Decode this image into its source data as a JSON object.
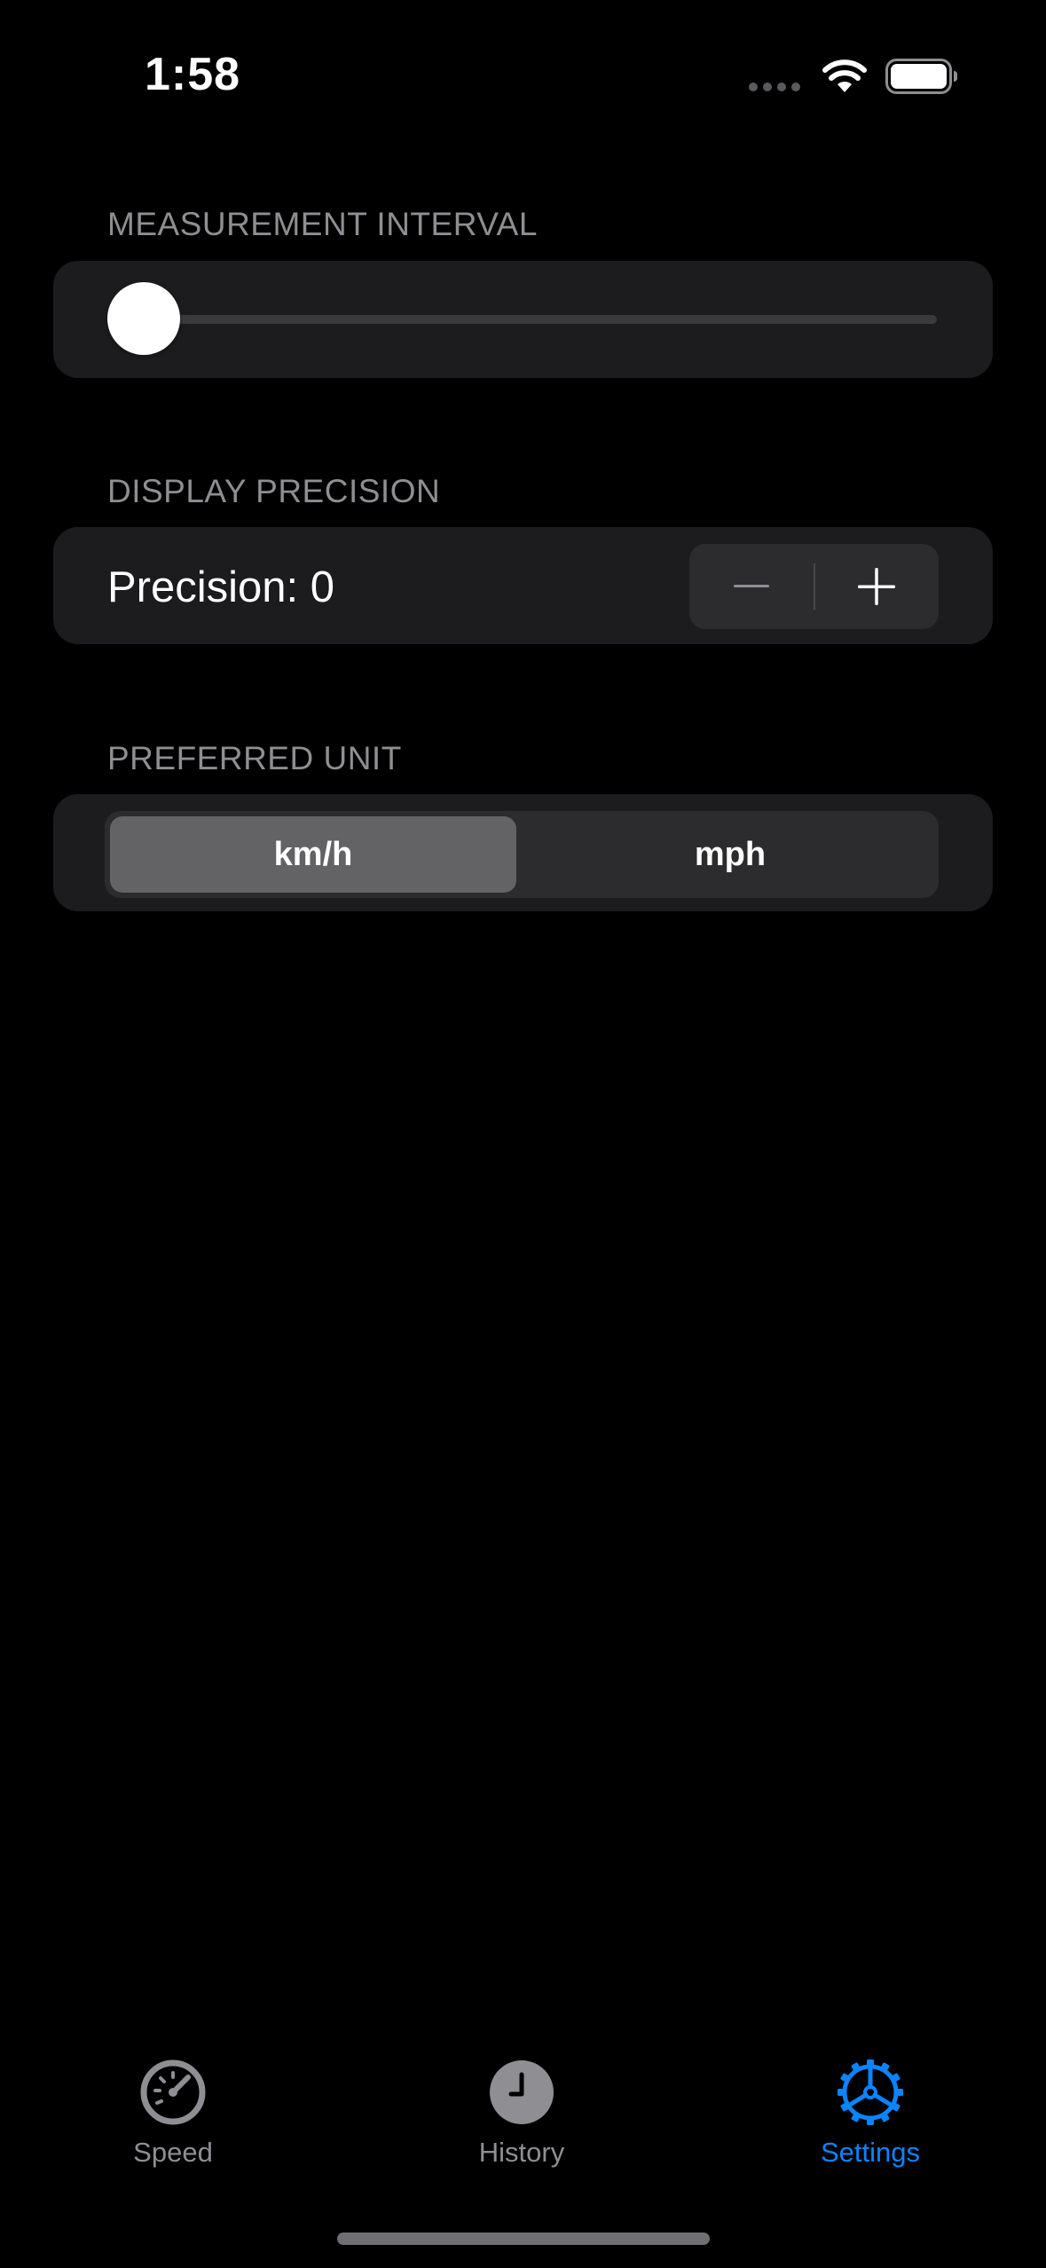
{
  "status_bar": {
    "time": "1:58"
  },
  "sections": {
    "measurement_interval": {
      "header": "MEASUREMENT INTERVAL",
      "slider_value_fraction": 0.0
    },
    "display_precision": {
      "header": "DISPLAY PRECISION",
      "label": "Precision: 0",
      "decrement_glyph": "−",
      "increment_glyph": "+"
    },
    "preferred_unit": {
      "header": "PREFERRED UNIT",
      "options": [
        "km/h",
        "mph"
      ],
      "selected_index": 0
    }
  },
  "tab_bar": {
    "items": [
      {
        "label": "Speed",
        "icon": "speedometer-icon",
        "active": false
      },
      {
        "label": "History",
        "icon": "clock-icon",
        "active": false
      },
      {
        "label": "Settings",
        "icon": "gear-icon",
        "active": true
      }
    ]
  },
  "colors": {
    "accent": "#0a84ff",
    "background": "#000000",
    "card": "#1c1c1e",
    "secondary_text": "#8e8e93",
    "inactive_icon": "#8e8e93"
  }
}
